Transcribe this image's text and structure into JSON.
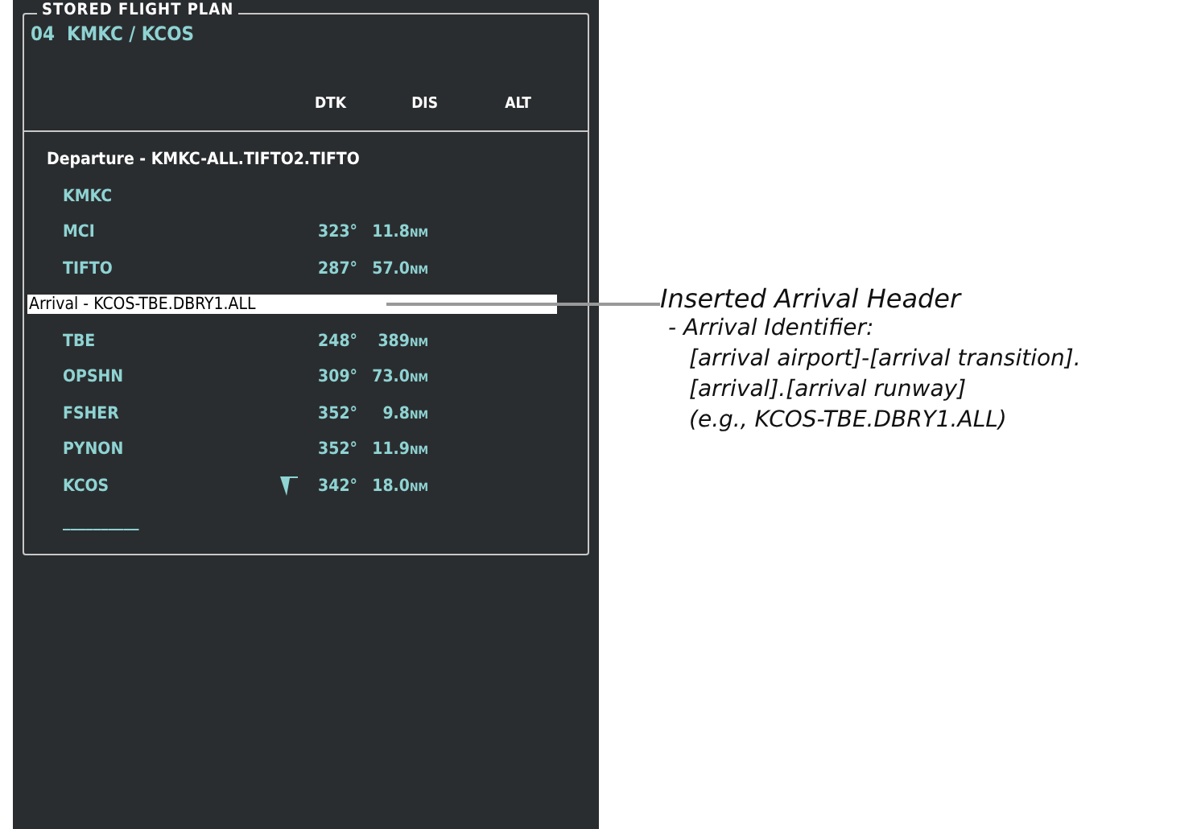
{
  "panel": {
    "title": "STORED FLIGHT PLAN",
    "plan": "04  KMKC / KCOS",
    "columns": [
      "DTK",
      "DIS",
      "ALT"
    ],
    "rows": [
      {
        "kind": "header",
        "label": "Departure - KMKC-ALL.TIFTO2.TIFTO",
        "highlighted": false
      },
      {
        "kind": "waypoint",
        "name": "KMKC",
        "active": false
      },
      {
        "kind": "waypoint",
        "name": "MCI",
        "dtk": "323°",
        "dis": "11.8",
        "unit": "NM",
        "active": false
      },
      {
        "kind": "waypoint",
        "name": "TIFTO",
        "dtk": "287°",
        "dis": "57.0",
        "unit": "NM",
        "active": false
      },
      {
        "kind": "header",
        "label": "Arrival - KCOS-TBE.DBRY1.ALL",
        "highlighted": true
      },
      {
        "kind": "waypoint",
        "name": "TBE",
        "dtk": "248°",
        "dis": "389",
        "unit": "NM",
        "active": false
      },
      {
        "kind": "waypoint",
        "name": "OPSHN",
        "dtk": "309°",
        "dis": "73.0",
        "unit": "NM",
        "active": false
      },
      {
        "kind": "waypoint",
        "name": "FSHER",
        "dtk": "352°",
        "dis": "9.8",
        "unit": "NM",
        "active": false
      },
      {
        "kind": "waypoint",
        "name": "PYNON",
        "dtk": "352°",
        "dis": "11.9",
        "unit": "NM",
        "active": false
      },
      {
        "kind": "waypoint",
        "name": "KCOS",
        "dtk": "342°",
        "dis": "18.0",
        "unit": "NM",
        "active": true
      },
      {
        "kind": "end",
        "name": "__________"
      }
    ]
  },
  "annotation": {
    "title": "Inserted Arrival Header",
    "lines": [
      "- Arrival Identifier:",
      "[arrival airport]-[arrival transition].",
      "[arrival].[arrival runway]",
      "(e.g., KCOS-TBE.DBRY1.ALL)"
    ]
  }
}
